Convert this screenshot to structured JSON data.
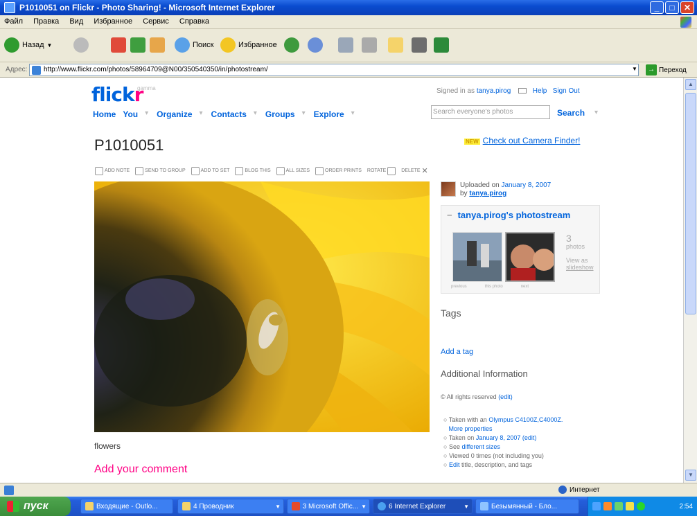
{
  "window": {
    "title": "P1010051 on Flickr - Photo Sharing! - Microsoft Internet Explorer",
    "minimize": "_",
    "maximize": "□",
    "close": "✕"
  },
  "menu": [
    "Файл",
    "Правка",
    "Вид",
    "Избранное",
    "Сервис",
    "Справка"
  ],
  "toolbar": {
    "back_label": "Назад",
    "search_label": "Поиск",
    "favorites_label": "Избранное"
  },
  "address": {
    "label": "Адрес:",
    "url": "http://www.flickr.com/photos/58964709@N00/350540350/in/photostream/",
    "go_label": "Переход"
  },
  "flickr": {
    "logo_a": "flick",
    "logo_b": "r",
    "logo_gamma": "gamma",
    "signed_in_prefix": "Signed in as",
    "username": "tanya.pirog",
    "help": "Help",
    "sign_out": "Sign Out",
    "nav": [
      "Home",
      "You",
      "Organize",
      "Contacts",
      "Groups",
      "Explore"
    ],
    "search_placeholder": "Search everyone's photos",
    "search_button": "Search"
  },
  "photo": {
    "title": "P1010051",
    "camera_finder_badge": "NEW",
    "camera_finder_link": "Check out Camera Finder!",
    "actions": [
      "ADD NOTE",
      "SEND TO GROUP",
      "ADD TO SET",
      "BLOG THIS",
      "ALL SIZES",
      "ORDER PRINTS",
      "ROTATE",
      "DELETE"
    ],
    "caption": "flowers",
    "add_comment": "Add your comment"
  },
  "sidebar": {
    "uploaded_prefix": "Uploaded on",
    "uploaded_date": "January 8, 2007",
    "by_prefix": "by",
    "uploader": "tanya.pirog",
    "stream_minus": "−",
    "stream_title": "tanya.pirog's photostream",
    "photo_count": "3",
    "photos_word": "photos",
    "view_as": "View as",
    "slideshow": "slideshow",
    "thumb_labels": [
      "previous",
      "this photo",
      "next"
    ],
    "tags_title": "Tags",
    "add_tag": "Add a tag",
    "additional_info": "Additional Information",
    "rights_text": "© All rights reserved",
    "rights_edit": "(edit)",
    "props": {
      "taken_with_prefix": "Taken with an",
      "camera": "Olympus C4100Z,C4000Z.",
      "more_props": "More properties",
      "taken_on_prefix": "Taken on",
      "taken_on_date": "January 8, 2007",
      "taken_edit": "(edit)",
      "see_prefix": "See",
      "different_sizes": "different sizes",
      "viewed": "Viewed 0 times (not including you)",
      "edit_prefix": "Edit",
      "edit_rest": "title, description, and tags"
    }
  },
  "statusbar": {
    "zone": "Интернет"
  },
  "taskbar": {
    "start": "пуск",
    "tasks": [
      "Входящие - Outlo...",
      "4 Проводник",
      "3 Microsoft Offic...",
      "6 Internet Explorer",
      "Безымянный - Бло..."
    ],
    "clock": "2:54"
  }
}
